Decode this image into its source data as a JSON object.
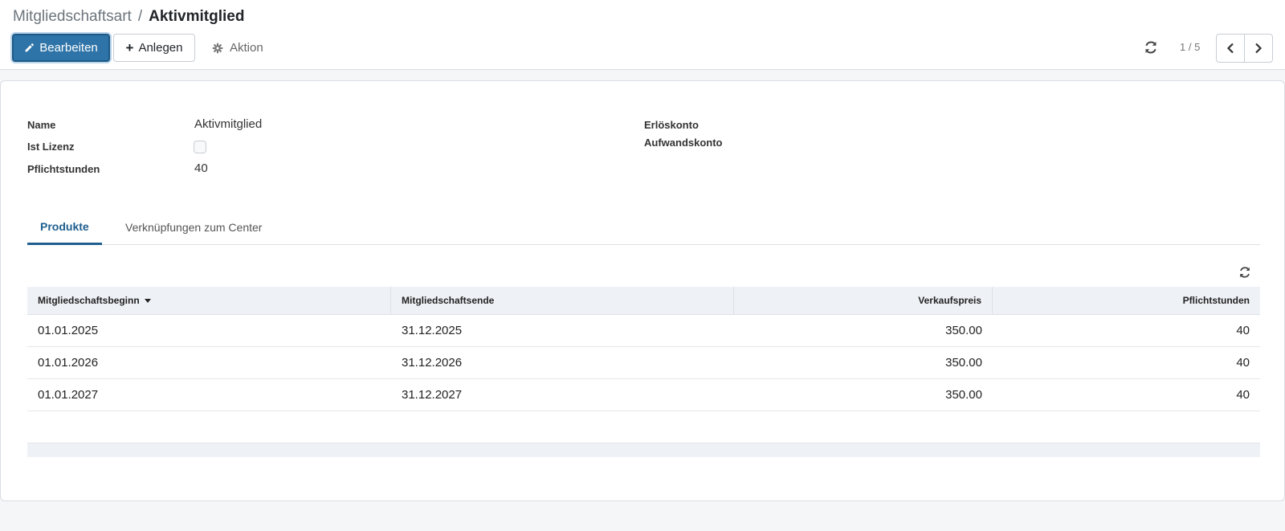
{
  "breadcrumb": {
    "parent": "Mitgliedschaftsart",
    "separator": "/",
    "current": "Aktivmitglied"
  },
  "toolbar": {
    "edit_label": "Bearbeiten",
    "create_label": "Anlegen",
    "action_label": "Aktion"
  },
  "pager": {
    "value": "1 / 5"
  },
  "form": {
    "name_label": "Name",
    "name_value": "Aktivmitglied",
    "license_label": "Ist Lizenz",
    "license_checked": false,
    "hours_label": "Pflichtstunden",
    "hours_value": "40",
    "revenue_account_label": "Erlöskonto",
    "expense_account_label": "Aufwandskonto"
  },
  "tabs": [
    {
      "label": "Produkte",
      "active": true
    },
    {
      "label": "Verknüpfungen zum Center",
      "active": false
    }
  ],
  "table": {
    "columns": [
      "Mitgliedschaftsbeginn",
      "Mitgliedschaftsende",
      "Verkaufspreis",
      "Pflichtstunden"
    ],
    "rows": [
      {
        "start": "01.01.2025",
        "end": "31.12.2025",
        "price": "350.00",
        "hours": "40"
      },
      {
        "start": "01.01.2026",
        "end": "31.12.2026",
        "price": "350.00",
        "hours": "40"
      },
      {
        "start": "01.01.2027",
        "end": "31.12.2027",
        "price": "350.00",
        "hours": "40"
      }
    ]
  },
  "colors": {
    "primary": "#2f74a8",
    "active_tab": "#1f5f8f",
    "table_header_bg": "#eef1f5"
  }
}
